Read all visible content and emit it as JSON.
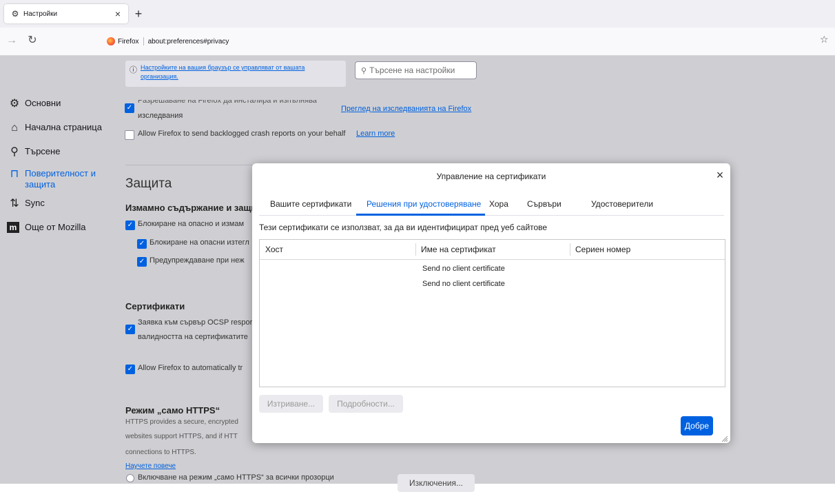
{
  "tab": {
    "title": "Настройки"
  },
  "nav": {
    "browser": "Firefox",
    "url": "about:preferences#privacy"
  },
  "sidebar": {
    "items": [
      {
        "label": "Основни",
        "icon": "gear-icon"
      },
      {
        "label": "Начална страница",
        "icon": "home-icon"
      },
      {
        "label": "Търсене",
        "icon": "search-icon"
      },
      {
        "label": "Поверителност и защита",
        "label_l1": "Поверителност и",
        "label_l2": "защита",
        "icon": "lock-icon",
        "selected": true
      },
      {
        "label": "Sync",
        "icon": "sync-icon"
      },
      {
        "label": "Още от Mozilla",
        "icon": "mozilla-icon"
      }
    ]
  },
  "content": {
    "org_notice_l1": "Настройките на вашия браузър се управляват от вашата",
    "org_notice_l2": "организация.",
    "search_placeholder": "Търсене на настройки",
    "studies_l1": "Разрешаване на Firefox да инсталира и изпълнява",
    "studies_l2": "изследвания",
    "studies_link": "Преглед на изследванията на Firefox",
    "crash_reports": "Allow Firefox to send backlogged crash reports on your behalf",
    "learn_more": "Learn more",
    "security_heading": "Защита",
    "deceptive_heading": "Измамно съдържание и защи",
    "block_dangerous": "Блокиране на опасно и измам",
    "block_downloads": "Блокиране на опасни изтегл",
    "warn_unwanted": "Предупреждаване при неж",
    "certs_heading": "Сертификати",
    "ocsp_l1": "Заявка към сървър OCSP respor",
    "ocsp_l2": "валидността на сертификатите",
    "auto_trust": "Allow Firefox to automatically tr",
    "https_heading": "Режим „само HTTPS“",
    "https_l1": "HTTPS provides a secure, encrypted",
    "https_l2": "websites support HTTPS, and if HTT",
    "https_l3": "connections to HTTPS.",
    "https_learn_more": "Научете повече",
    "https_all_windows": "Включване на режим „само HTTPS“ за всички прозорци",
    "exceptions_button": "Изключения..."
  },
  "dialog": {
    "title": "Управление на сертификати",
    "tabs": [
      "Вашите сертификати",
      "Решения при удостоверяване",
      "Хора",
      "Сървъри",
      "Удостоверители"
    ],
    "selected_tab": 1,
    "description": "Тези сертификати се използват, за да ви идентифицират пред уеб сайтове",
    "columns": [
      "Хост",
      "Име на сертификат",
      "Сериен номер"
    ],
    "rows": [
      {
        "host": "",
        "name": "Send no client certificate",
        "serial": ""
      },
      {
        "host": "",
        "name": "Send no client certificate",
        "serial": ""
      }
    ],
    "delete_button": "Изтриване...",
    "details_button": "Подробности...",
    "ok_button": "Добре"
  },
  "colors": {
    "accent": "#0061e0",
    "page_overlay": "#cfcfd3",
    "dialog_bg": "#ffffff"
  }
}
